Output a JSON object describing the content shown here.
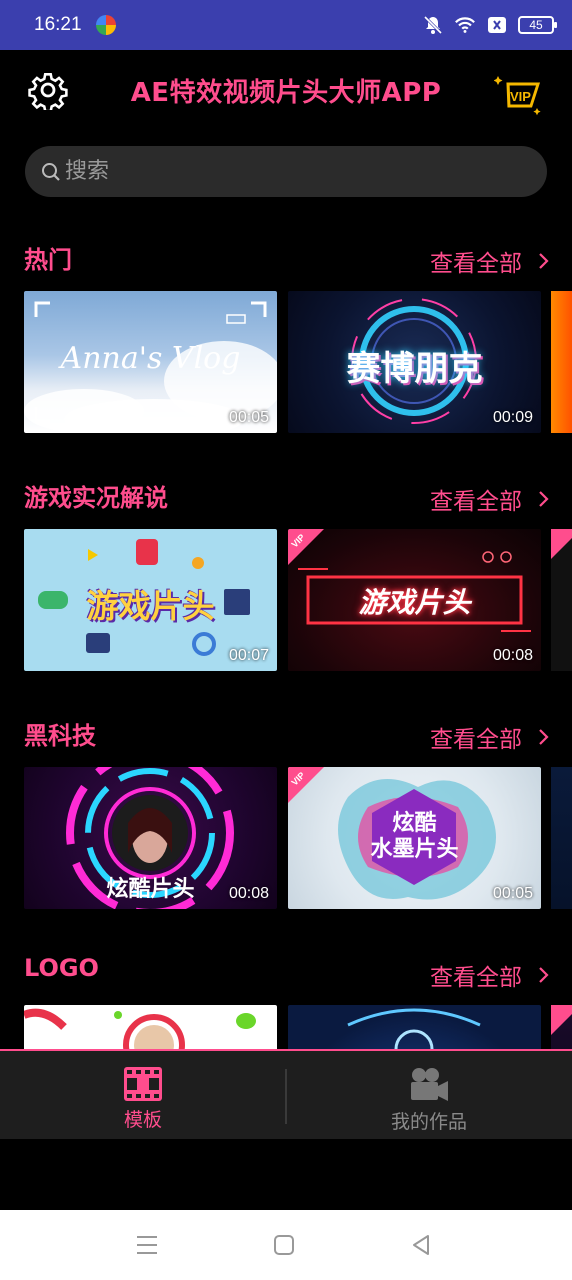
{
  "status": {
    "time": "16:21",
    "battery": "45"
  },
  "header": {
    "title": "AE特效视频片头大师APP",
    "vip_label": "VIP"
  },
  "search": {
    "placeholder": "搜索"
  },
  "sections": [
    {
      "title": "热门",
      "see_all": "查看全部",
      "cards": [
        {
          "title": "Anna's Vlog",
          "duration": "00:05",
          "vip": false
        },
        {
          "title": "赛博朋克",
          "duration": "00:09",
          "vip": false
        }
      ]
    },
    {
      "title": "游戏实况解说",
      "see_all": "查看全部",
      "cards": [
        {
          "title": "游戏片头",
          "duration": "00:07",
          "vip": false
        },
        {
          "title": "游戏片头",
          "duration": "00:08",
          "vip": true
        }
      ]
    },
    {
      "title": "黑科技",
      "see_all": "查看全部",
      "cards": [
        {
          "title": "炫酷片头",
          "duration": "00:08",
          "vip": false
        },
        {
          "title": "炫酷水墨片头",
          "title_line1": "炫酷",
          "title_line2": "水墨片头",
          "duration": "00:05",
          "vip": true
        }
      ]
    },
    {
      "title": "LOGO",
      "see_all": "查看全部",
      "cards": []
    }
  ],
  "bottom_nav": [
    {
      "label": "模板",
      "active": true
    },
    {
      "label": "我的作品",
      "active": false
    }
  ],
  "colors": {
    "accent": "#ff4d8d",
    "status_bar": "#3b3fae",
    "vip_gold": "#f5b800"
  }
}
